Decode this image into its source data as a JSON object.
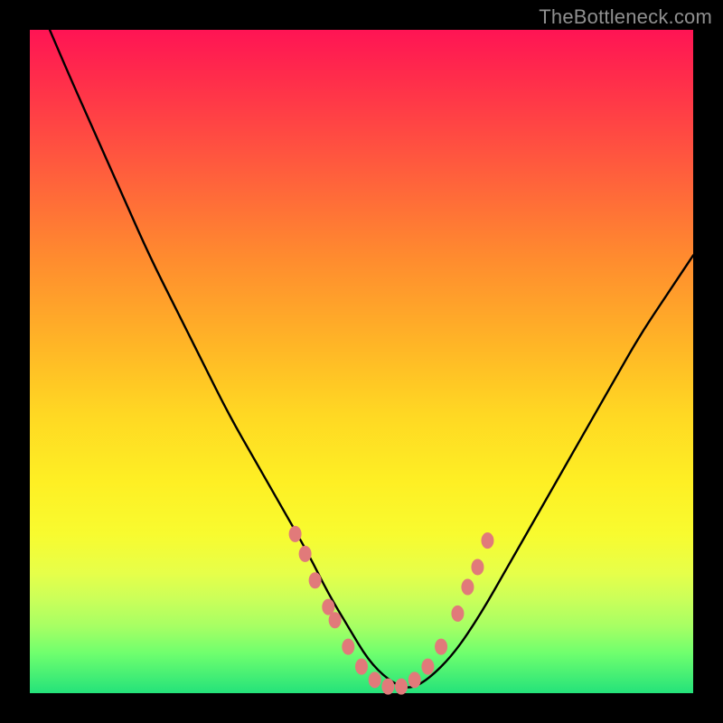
{
  "watermark": "TheBottleneck.com",
  "colors": {
    "frame": "#000000",
    "curve": "#000000",
    "marker": "#e17a7a",
    "gradient_top": "#ff1454",
    "gradient_bottom": "#24e27a"
  },
  "chart_data": {
    "type": "line",
    "title": "",
    "xlabel": "",
    "ylabel": "",
    "xlim": [
      0,
      100
    ],
    "ylim": [
      0,
      100
    ],
    "annotations": [
      "TheBottleneck.com"
    ],
    "series": [
      {
        "name": "bottleneck-curve",
        "x": [
          3,
          6,
          10,
          14,
          18,
          22,
          26,
          30,
          34,
          38,
          42,
          45,
          48,
          51,
          54,
          57,
          60,
          64,
          68,
          72,
          76,
          80,
          84,
          88,
          92,
          96,
          100
        ],
        "y": [
          100,
          93,
          84,
          75,
          66,
          58,
          50,
          42,
          35,
          28,
          21,
          15,
          10,
          5,
          2,
          0.5,
          2,
          6,
          12,
          19,
          26,
          33,
          40,
          47,
          54,
          60,
          66
        ]
      }
    ],
    "markers": {
      "name": "highlight-points",
      "x": [
        40,
        41.5,
        43,
        45,
        46,
        48,
        50,
        52,
        54,
        56,
        58,
        60,
        62,
        64.5,
        66,
        67.5,
        69
      ],
      "y": [
        24,
        21,
        17,
        13,
        11,
        7,
        4,
        2,
        1,
        1,
        2,
        4,
        7,
        12,
        16,
        19,
        23
      ]
    }
  }
}
